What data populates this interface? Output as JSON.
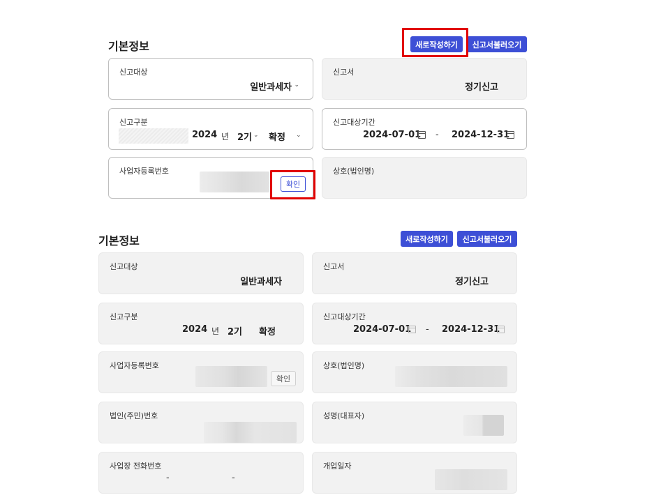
{
  "top": {
    "title": "기본정보",
    "buttons": {
      "new": "새로작성하기",
      "load": "신고서불러오기"
    },
    "fields": {
      "report_target": {
        "label": "신고대상",
        "value": "일반과세자"
      },
      "report_form": {
        "label": "신고서",
        "value": "정기신고"
      },
      "report_type": {
        "label": "신고구분",
        "year": "2024",
        "year_unit": "년",
        "term": "2기",
        "status": "확정"
      },
      "period": {
        "label": "신고대상기간",
        "start": "2024-07-01",
        "separator": "-",
        "end": "2024-12-31"
      },
      "biz_no": {
        "label": "사업자등록번호",
        "confirm": "확인"
      },
      "company": {
        "label": "상호(법인명)"
      }
    }
  },
  "bottom": {
    "title": "기본정보",
    "buttons": {
      "new": "새로작성하기",
      "load": "신고서불러오기"
    },
    "fields": {
      "report_target": {
        "label": "신고대상",
        "value": "일반과세자"
      },
      "report_form": {
        "label": "신고서",
        "value": "정기신고"
      },
      "report_type": {
        "label": "신고구분",
        "year": "2024",
        "year_unit": "년",
        "term": "2기",
        "status": "확정"
      },
      "period": {
        "label": "신고대상기간",
        "start": "2024-07-01",
        "separator": "-",
        "end": "2024-12-31"
      },
      "biz_no": {
        "label": "사업자등록번호",
        "confirm": "확인"
      },
      "company": {
        "label": "상호(법인명)"
      },
      "corp_no": {
        "label": "법인(주민)번호"
      },
      "rep_name": {
        "label": "성명(대표자)"
      },
      "phone": {
        "label": "사업장 전화번호",
        "sep1": "-",
        "sep2": "-"
      },
      "open_date": {
        "label": "개업일자"
      }
    }
  },
  "colors": {
    "accent": "#3d4fd6",
    "highlight": "#e10000",
    "readonly_bg": "#f2f2f2"
  },
  "icons": [
    "chevron-down-icon",
    "calendar-icon"
  ]
}
